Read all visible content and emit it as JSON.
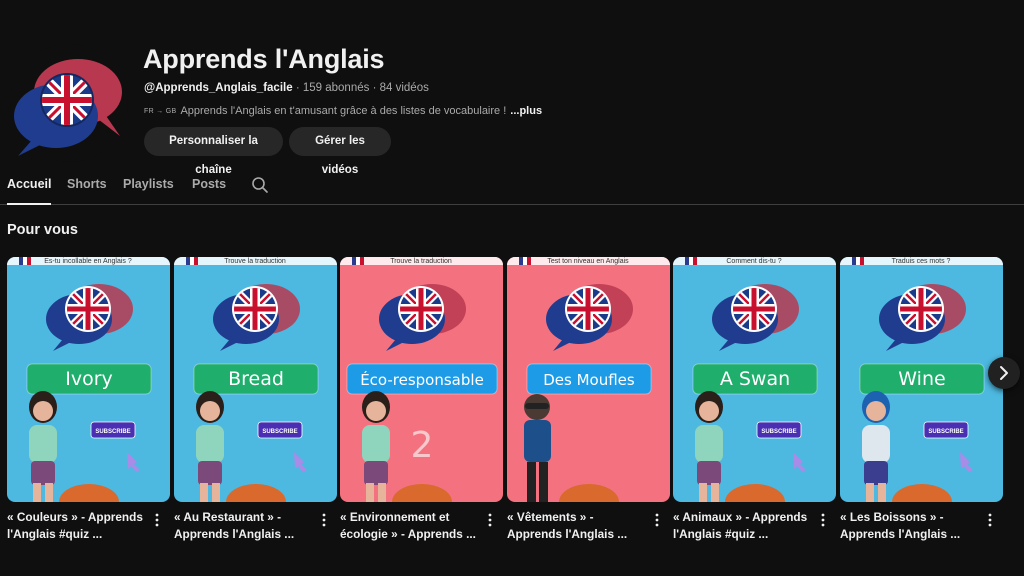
{
  "channel": {
    "name": "Apprends l'Anglais",
    "handle": "@Apprends_Anglais_facile",
    "separator": " · ",
    "subscribers": "159 abonnés",
    "videos": "84 vidéos",
    "description_prefix": "FR → GB",
    "description": "Apprends l'Anglais en t'amusant grâce à des listes de vocabulaire !",
    "more_label": "...plus"
  },
  "actions": {
    "customize_label": "Personnaliser la chaîne",
    "manage_label": "Gérer les vidéos"
  },
  "tabs": [
    {
      "label": "Accueil",
      "active": true
    },
    {
      "label": "Shorts",
      "active": false
    },
    {
      "label": "Playlists",
      "active": false
    },
    {
      "label": "Posts",
      "active": false
    }
  ],
  "section": {
    "title": "Pour vous"
  },
  "shorts": [
    {
      "title_line1": "« Couleurs » - Apprends",
      "title_line2": "l'Anglais #quiz ...",
      "word": "Ivory",
      "top_text": "Es-tu incollable en Anglais ?",
      "bg": "#4db8e0",
      "banner": "#1fae6b",
      "character": "girl",
      "subscribe": "SUBSCRIBE",
      "overlay_number": ""
    },
    {
      "title_line1": "« Au Restaurant » -",
      "title_line2": "Apprends l'Anglais ...",
      "word": "Bread",
      "top_text": "Trouve la traduction",
      "bg": "#4db8e0",
      "banner": "#1fae6b",
      "character": "girl",
      "subscribe": "SUBSCRIBE",
      "overlay_number": ""
    },
    {
      "title_line1": "« Environnement et",
      "title_line2": "écologie » - Apprends ...",
      "word": "Éco-responsable",
      "top_text": "Trouve la traduction",
      "bg": "#f4727f",
      "banner": "#1e9be6",
      "character": "girl2",
      "subscribe": "",
      "overlay_number": "2"
    },
    {
      "title_line1": "« Vêtements » -",
      "title_line2": "Apprends l'Anglais ...",
      "word": "Des Moufles",
      "top_text": "Test ton niveau en Anglais",
      "bg": "#f4727f",
      "banner": "#1e9be6",
      "character": "boy",
      "subscribe": "",
      "overlay_number": ""
    },
    {
      "title_line1": "« Animaux » - Apprends",
      "title_line2": "l'Anglais #quiz ...",
      "word": "A Swan",
      "top_text": "Comment dis-tu ?",
      "bg": "#4db8e0",
      "banner": "#1fae6b",
      "character": "girl3",
      "subscribe": "SUBSCRIBE",
      "overlay_number": ""
    },
    {
      "title_line1": "« Les Boissons » -",
      "title_line2": "Apprends l'Anglais ...",
      "word": "Wine",
      "top_text": "Traduis ces mots ?",
      "bg": "#4db8e0",
      "banner": "#1fae6b",
      "character": "girl4",
      "subscribe": "SUBSCRIBE",
      "overlay_number": ""
    }
  ],
  "icons": {
    "search": "search-icon",
    "kebab": "more-vert-icon",
    "next": "chevron-right-icon"
  }
}
